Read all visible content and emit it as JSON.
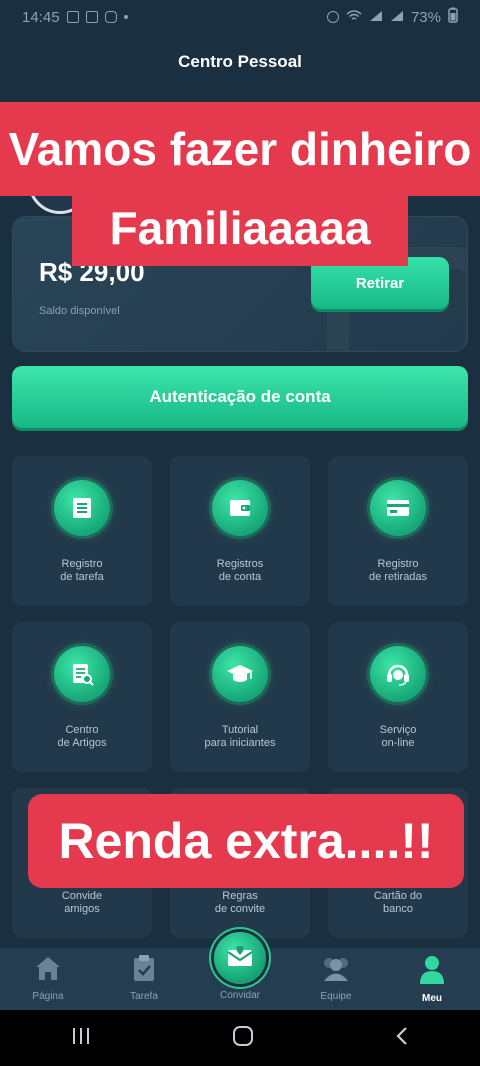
{
  "status_bar": {
    "time": "14:45",
    "battery": "73%"
  },
  "header": {
    "title": "Centro Pessoal"
  },
  "balance": {
    "amount": "R$ 29,00",
    "label": "Saldo disponível",
    "withdraw_label": "Retirar"
  },
  "auth_button": {
    "label": "Autenticação de conta"
  },
  "menu": [
    {
      "label": "Registro\nde tarefa",
      "icon": "task-record-icon"
    },
    {
      "label": "Registros\nde conta",
      "icon": "wallet-icon"
    },
    {
      "label": "Registro\nde retiradas",
      "icon": "card-icon"
    },
    {
      "label": "Centro\nde Artigos",
      "icon": "article-search-icon"
    },
    {
      "label": "Tutorial\npara iniciantes",
      "icon": "graduation-cap-icon"
    },
    {
      "label": "Serviço\non-line",
      "icon": "headset-icon"
    },
    {
      "label": "Convide\namigos",
      "icon": "invite-friends-icon"
    },
    {
      "label": "Regras\nde convite",
      "icon": "rules-icon"
    },
    {
      "label": "Cartão do\nbanco",
      "icon": "bank-card-icon"
    }
  ],
  "tabs": [
    {
      "label": "Página",
      "icon": "home-icon"
    },
    {
      "label": "Tarefa",
      "icon": "clipboard-icon"
    },
    {
      "label": "Convidar",
      "icon": "envelope-heart-icon"
    },
    {
      "label": "Equipe",
      "icon": "team-icon"
    },
    {
      "label": "Meu",
      "icon": "user-icon"
    }
  ],
  "overlays": {
    "line1": "Vamos fazer dinheiro",
    "line2": "Familiaaaaa",
    "line3": "Renda extra....!!"
  },
  "colors": {
    "accent": "#2fd99e",
    "background": "#1a2f3f",
    "overlay": "#e53a4d"
  }
}
